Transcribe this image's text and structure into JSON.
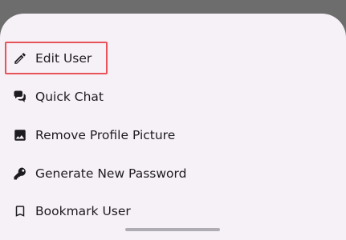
{
  "menu": {
    "items": [
      {
        "id": "edit-user",
        "label": "Edit User",
        "icon": "pencil-icon",
        "highlighted": true
      },
      {
        "id": "quick-chat",
        "label": "Quick Chat",
        "icon": "chat-bubbles-icon",
        "highlighted": false
      },
      {
        "id": "remove-profile-picture",
        "label": "Remove Profile Picture",
        "icon": "image-icon",
        "highlighted": false
      },
      {
        "id": "generate-new-password",
        "label": "Generate New Password",
        "icon": "key-icon",
        "highlighted": false
      },
      {
        "id": "bookmark-user",
        "label": "Bookmark User",
        "icon": "bookmark-icon",
        "highlighted": false
      }
    ]
  },
  "colors": {
    "sheet_background": "#f6f1f7",
    "scrim": "#6d6d6d",
    "highlight_border": "#e8535a",
    "text": "#1d1b20"
  }
}
